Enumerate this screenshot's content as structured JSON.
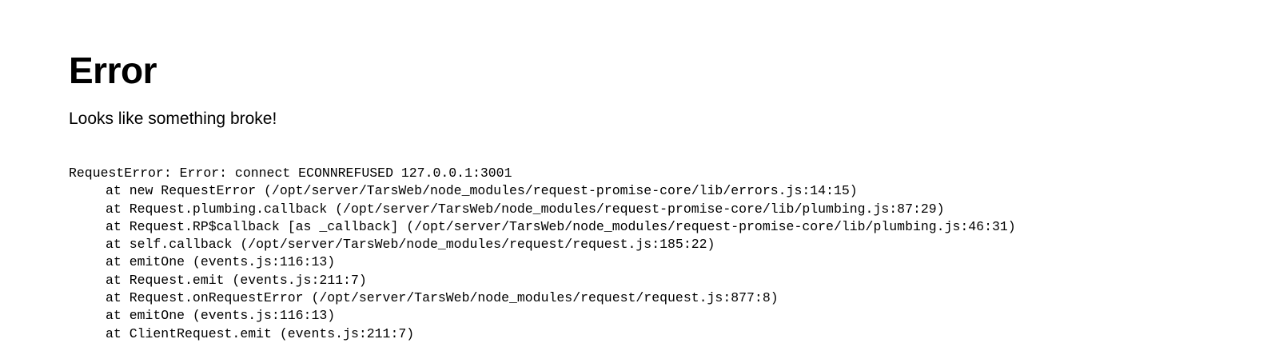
{
  "error_page": {
    "title": "Error",
    "message": "Looks like something broke!",
    "stack": {
      "header": "RequestError: Error: connect ECONNREFUSED 127.0.0.1:3001",
      "frames": [
        "at new RequestError (/opt/server/TarsWeb/node_modules/request-promise-core/lib/errors.js:14:15)",
        "at Request.plumbing.callback (/opt/server/TarsWeb/node_modules/request-promise-core/lib/plumbing.js:87:29)",
        "at Request.RP$callback [as _callback] (/opt/server/TarsWeb/node_modules/request-promise-core/lib/plumbing.js:46:31)",
        "at self.callback (/opt/server/TarsWeb/node_modules/request/request.js:185:22)",
        "at emitOne (events.js:116:13)",
        "at Request.emit (events.js:211:7)",
        "at Request.onRequestError (/opt/server/TarsWeb/node_modules/request/request.js:877:8)",
        "at emitOne (events.js:116:13)",
        "at ClientRequest.emit (events.js:211:7)"
      ]
    }
  }
}
